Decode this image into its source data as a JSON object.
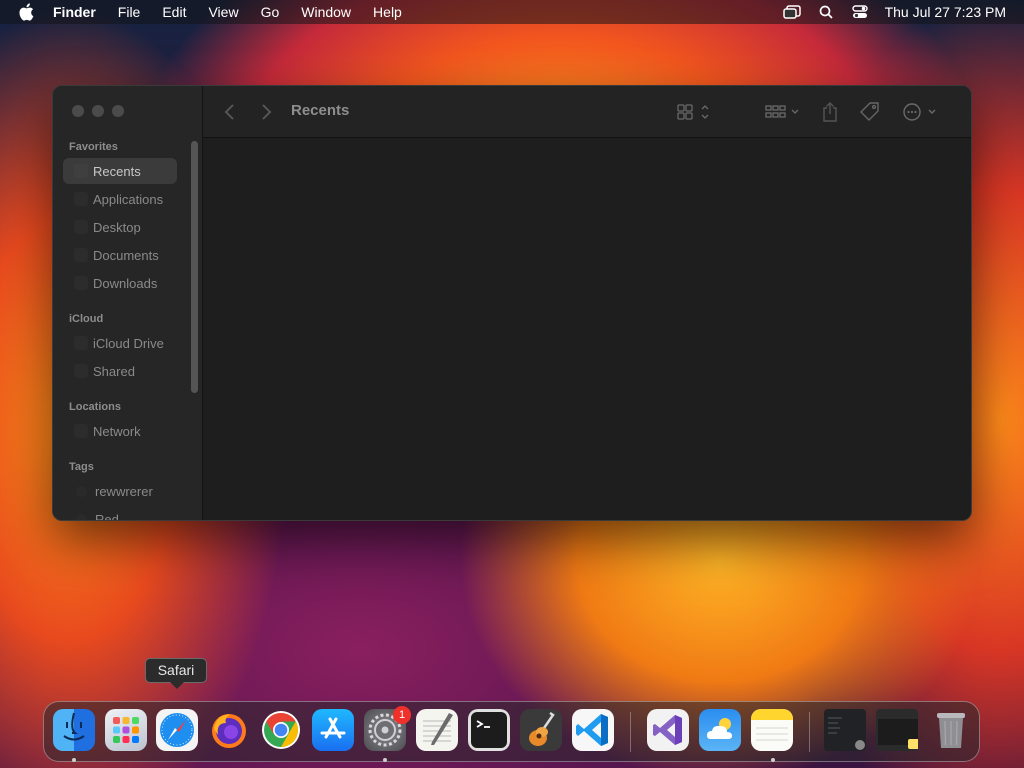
{
  "menubar": {
    "app_name": "Finder",
    "menus": [
      "File",
      "Edit",
      "View",
      "Go",
      "Window",
      "Help"
    ],
    "clock": "Thu Jul 27  7:23 PM"
  },
  "finder": {
    "title": "Recents",
    "sidebar": {
      "favorites_header": "Favorites",
      "favorites": [
        "Recents",
        "Applications",
        "Desktop",
        "Documents",
        "Downloads"
      ],
      "icloud_header": "iCloud",
      "icloud": [
        "iCloud Drive",
        "Shared"
      ],
      "locations_header": "Locations",
      "locations": [
        "Network"
      ],
      "tags_header": "Tags",
      "tags": [
        "rewwrerer",
        "Red"
      ]
    }
  },
  "tooltip": {
    "label": "Safari"
  },
  "dock": {
    "apps": [
      {
        "name": "finder-icon"
      },
      {
        "name": "launchpad-icon"
      },
      {
        "name": "safari-icon"
      },
      {
        "name": "firefox-icon"
      },
      {
        "name": "chrome-icon"
      },
      {
        "name": "app-store-icon"
      },
      {
        "name": "system-settings-icon",
        "badge": "1"
      },
      {
        "name": "textedit-icon"
      },
      {
        "name": "terminal-icon"
      },
      {
        "name": "garageband-icon"
      },
      {
        "name": "vscode-icon"
      },
      {
        "name": "visual-studio-icon"
      },
      {
        "name": "weather-icon"
      },
      {
        "name": "notes-icon"
      },
      {
        "name": "recent-window-1-icon"
      },
      {
        "name": "recent-window-2-icon"
      },
      {
        "name": "trash-icon"
      }
    ]
  }
}
